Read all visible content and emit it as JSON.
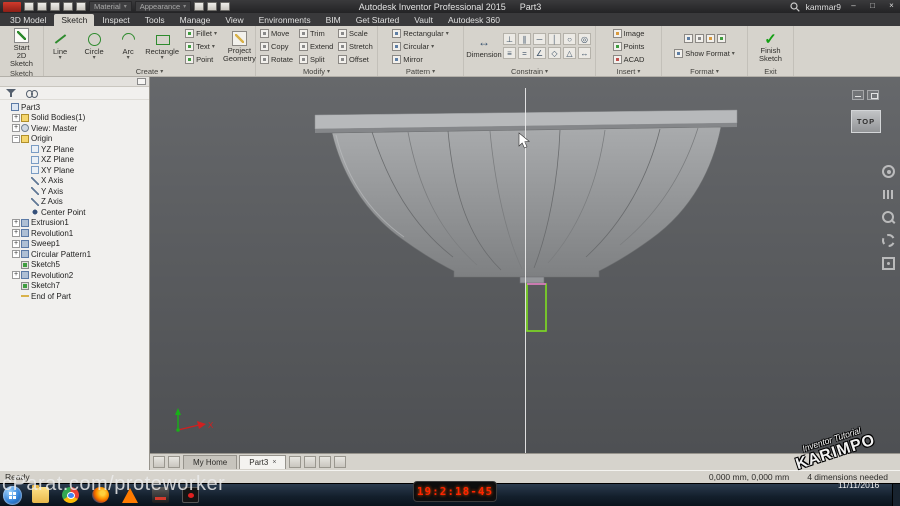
{
  "ui": {
    "caret": "▾"
  },
  "titlebar": {
    "title": "Autodesk Inventor Professional 2015",
    "doc": "Part3",
    "material": "Material",
    "appearance": "Appearance",
    "user": "kammar9",
    "window": {
      "min": "–",
      "max": "□",
      "close": "×"
    }
  },
  "ribbon_tabs": [
    "3D Model",
    "Sketch",
    "Inspect",
    "Tools",
    "Manage",
    "View",
    "Environments",
    "BIM",
    "Get Started",
    "Vault",
    "Autodesk 360"
  ],
  "active_tab_index": 1,
  "panels": {
    "sketch": {
      "label": "Sketch",
      "start2d_line1": "Start",
      "start2d_line2": "2D Sketch"
    },
    "create": {
      "label": "Create",
      "big": [
        {
          "label": "Line",
          "icon": "line"
        },
        {
          "label": "Circle",
          "icon": "circle"
        },
        {
          "label": "Arc",
          "icon": "arc"
        },
        {
          "label": "Rectangle",
          "icon": "rectangle"
        }
      ],
      "small": [
        {
          "label": "Fillet",
          "icon": "fillet",
          "caret": true
        },
        {
          "label": "Text",
          "icon": "text",
          "caret": true
        },
        {
          "label": "Point",
          "icon": "point",
          "caret": false
        }
      ],
      "project_line1": "Project",
      "project_line2": "Geometry"
    },
    "modify": {
      "label": "Modify",
      "items": [
        {
          "label": "Move",
          "icon": "move"
        },
        {
          "label": "Trim",
          "icon": "trim"
        },
        {
          "label": "Scale",
          "icon": "scale"
        },
        {
          "label": "Copy",
          "icon": "copy"
        },
        {
          "label": "Extend",
          "icon": "extend"
        },
        {
          "label": "Stretch",
          "icon": "stretch"
        },
        {
          "label": "Rotate",
          "icon": "rotate"
        },
        {
          "label": "Split",
          "icon": "split"
        },
        {
          "label": "Offset",
          "icon": "offset"
        }
      ]
    },
    "pattern": {
      "label": "Pattern",
      "items": [
        {
          "label": "Rectangular",
          "icon": "rectangular-pattern",
          "caret": true
        },
        {
          "label": "Circular",
          "icon": "circular-pattern",
          "caret": true
        },
        {
          "label": "Mirror",
          "icon": "mirror",
          "caret": false
        }
      ]
    },
    "constrain": {
      "label": "Constrain",
      "dimension": "Dimension",
      "icons": [
        {
          "glyph": "⊥",
          "name": "perpendicular"
        },
        {
          "glyph": "∥",
          "name": "parallel"
        },
        {
          "glyph": "─",
          "name": "horizontal"
        },
        {
          "glyph": "│",
          "name": "vertical"
        },
        {
          "glyph": "○",
          "name": "tangent"
        },
        {
          "glyph": "◎",
          "name": "concentric"
        },
        {
          "glyph": "≡",
          "name": "collinear"
        },
        {
          "glyph": "=",
          "name": "equal"
        },
        {
          "glyph": "∠",
          "name": "coincident"
        },
        {
          "glyph": "◇",
          "name": "symmetric"
        },
        {
          "glyph": "△",
          "name": "fix"
        },
        {
          "glyph": "↔",
          "name": "smooth"
        }
      ]
    },
    "insert": {
      "label": "Insert",
      "items": [
        {
          "label": "Image",
          "icon": "image",
          "tone": "o"
        },
        {
          "label": "Points",
          "icon": "points",
          "tone": "g"
        },
        {
          "label": "ACAD",
          "icon": "acad",
          "tone": "r"
        }
      ]
    },
    "format": {
      "label": "Format",
      "show_format": "Show Format"
    },
    "exit": {
      "label": "Exit",
      "finish_line1": "Finish",
      "finish_line2": "Sketch"
    }
  },
  "browser": {
    "tree": [
      {
        "label": "Part3",
        "depth": 0,
        "icon": "part"
      },
      {
        "label": "Solid Bodies(1)",
        "depth": 1,
        "icon": "folder",
        "expand": "plus"
      },
      {
        "label": "View: Master",
        "depth": 1,
        "icon": "view",
        "expand": "plus"
      },
      {
        "label": "Origin",
        "depth": 1,
        "icon": "folder",
        "expand": "minus"
      },
      {
        "label": "YZ Plane",
        "depth": 2,
        "icon": "plane"
      },
      {
        "label": "XZ Plane",
        "depth": 2,
        "icon": "plane"
      },
      {
        "label": "XY Plane",
        "depth": 2,
        "icon": "plane"
      },
      {
        "label": "X Axis",
        "depth": 2,
        "icon": "axis"
      },
      {
        "label": "Y Axis",
        "depth": 2,
        "icon": "axis"
      },
      {
        "label": "Z Axis",
        "depth": 2,
        "icon": "axis"
      },
      {
        "label": "Center Point",
        "depth": 2,
        "icon": "point"
      },
      {
        "label": "Extrusion1",
        "depth": 1,
        "icon": "extrusion",
        "expand": "plus"
      },
      {
        "label": "Revolution1",
        "depth": 1,
        "icon": "revolution",
        "expand": "plus"
      },
      {
        "label": "Sweep1",
        "depth": 1,
        "icon": "sweep",
        "expand": "plus"
      },
      {
        "label": "Circular Pattern1",
        "depth": 1,
        "icon": "circular-pattern",
        "expand": "plus"
      },
      {
        "label": "Sketch5",
        "depth": 1,
        "icon": "sketch"
      },
      {
        "label": "Revolution2",
        "depth": 1,
        "icon": "revolution",
        "expand": "plus"
      },
      {
        "label": "Sketch7",
        "depth": 1,
        "icon": "sketch"
      },
      {
        "label": "End of Part",
        "depth": 1,
        "icon": "end-of-part"
      }
    ]
  },
  "viewport": {
    "viewcube_face": "TOP",
    "triad": {
      "x": "X"
    },
    "nav_icons": [
      "navigation-wheel",
      "pan",
      "zoom",
      "orbit",
      "look-at"
    ],
    "docbar": {
      "tabs": [
        {
          "label": "My Home",
          "active": false
        },
        {
          "label": "Part3",
          "active": true
        }
      ],
      "close_glyph": "×"
    }
  },
  "statusbar": {
    "ready": "Ready",
    "coords": "0,000 mm, 0,000 mm",
    "hint": "4 dimensions needed"
  },
  "taskbar": {
    "icons": [
      "start",
      "explorer",
      "chrome",
      "firefox",
      "vlc",
      "inventor",
      "recorder"
    ]
  },
  "overlays": {
    "watermark": "cParat.com/proteworker",
    "timer": "19:2:18-45",
    "date": "11/11/2016",
    "stamp_top": "Inventor Tutorial",
    "stamp_main": "KARIMPO"
  }
}
